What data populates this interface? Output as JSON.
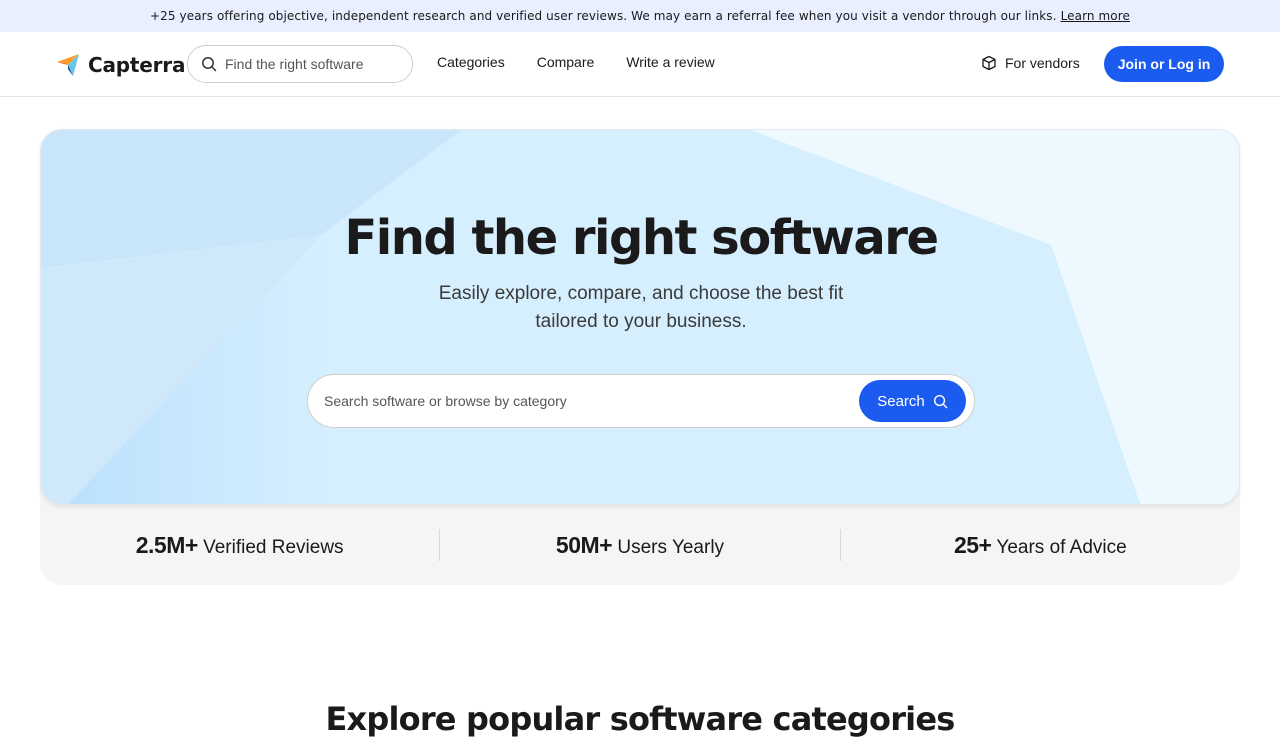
{
  "banner": {
    "text": "+25 years offering objective, independent research and verified user reviews. We may earn a referral fee when you visit a vendor through our links.",
    "link": "Learn more"
  },
  "nav": {
    "logo": "Capterra",
    "search_placeholder": "Find the right software",
    "links": [
      "Categories",
      "Compare",
      "Write a review"
    ],
    "vendors": "For vendors",
    "join": "Join or Log in"
  },
  "hero": {
    "title": "Find the right software",
    "subtitle": "Easily explore, compare, and choose the best fit tailored to your business.",
    "search_placeholder": "Search software or browse by category",
    "search_button": "Search"
  },
  "stats": [
    {
      "value": "2.5M+",
      "label": "Verified Reviews"
    },
    {
      "value": "50M+",
      "label": "Users Yearly"
    },
    {
      "value": "25+",
      "label": "Years of Advice"
    }
  ],
  "explore_title": "Explore popular software categories",
  "colors": {
    "accent": "#1b5bf0",
    "banner_bg": "#e9efff",
    "hero_bg": "#dcefff"
  }
}
